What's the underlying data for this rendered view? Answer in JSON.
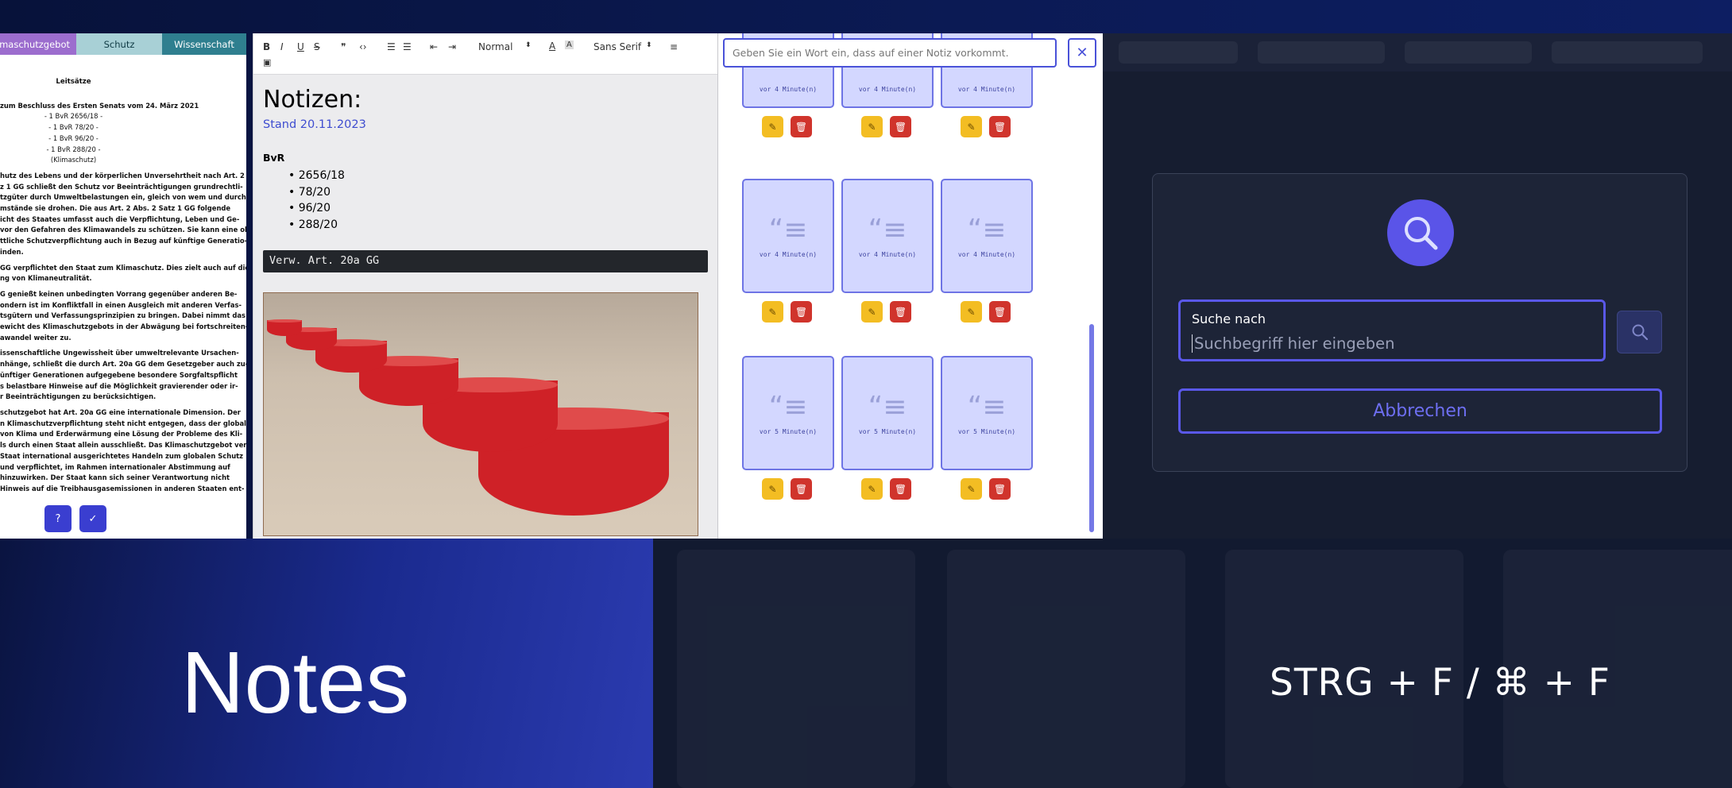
{
  "doc": {
    "tabs": [
      "Klimaschutzgebot",
      "Schutz",
      "Wissenschaft"
    ],
    "heading": "Leitsätze",
    "lines": [
      {
        "text": "zum Beschluss des Ersten Senats vom 24. März 2021",
        "bold": true
      },
      {
        "text": "- 1 BvR 2656/18 -",
        "center": true
      },
      {
        "text": "- 1 BvR 78/20 -",
        "center": true
      },
      {
        "text": "- 1 BvR 96/20 -",
        "center": true
      },
      {
        "text": "- 1 BvR 288/20 -",
        "center": true
      },
      {
        "text": "(Klimaschutz)",
        "center": true
      },
      {
        "text": "",
        "gap": true
      },
      {
        "text": "hutz des Lebens und der körperlichen Unversehrtheit nach Art. 2",
        "bold": true
      },
      {
        "text": "z 1 GG schließt den Schutz vor Beeinträchtigungen grundrechtli-",
        "bold": true
      },
      {
        "text": "tzgüter durch Umweltbelastungen ein, gleich von wem und durch",
        "bold": true
      },
      {
        "text": "mstände sie drohen. Die aus Art. 2 Abs. 2 Satz 1 GG folgende",
        "bold": true
      },
      {
        "text": "icht des Staates umfasst auch die Verpflichtung, Leben und Ge-",
        "bold": true
      },
      {
        "text": "vor den Gefahren des Klimawandels zu schützen. Sie kann eine ob-",
        "bold": true
      },
      {
        "text": "ttliche Schutzverpflichtung auch in Bezug auf künftige Generatio-",
        "bold": true
      },
      {
        "text": "inden.",
        "bold": true
      },
      {
        "text": "",
        "gap": true
      },
      {
        "text": "GG verpflichtet den Staat zum Klimaschutz. Dies zielt auch auf die",
        "bold": true
      },
      {
        "text": "ng von Klimaneutralität.",
        "bold": true
      },
      {
        "text": "",
        "gap": true
      },
      {
        "text": "G genießt keinen unbedingten Vorrang gegenüber anderen Be-",
        "bold": true
      },
      {
        "text": "ondern ist im Konfliktfall in einen Ausgleich mit anderen Verfas-",
        "bold": true
      },
      {
        "text": "tsgütern und Verfassungsprinzipien zu bringen. Dabei nimmt das",
        "bold": true
      },
      {
        "text": "ewicht des Klimaschutzgebots in der Abwägung bei fortschreiten-",
        "bold": true
      },
      {
        "text": "awandel weiter zu.",
        "bold": true
      },
      {
        "text": "",
        "gap": true
      },
      {
        "text": "issenschaftliche Ungewissheit über umweltrelevante Ursachen-",
        "bold": true
      },
      {
        "text": "nhänge, schließt die durch Art. 20a GG dem Gesetzgeber auch zu-",
        "bold": true
      },
      {
        "text": "ünftiger Generationen aufgegebene besondere Sorgfaltspflicht",
        "bold": true
      },
      {
        "text": "s belastbare Hinweise auf die Möglichkeit gravierender oder ir-",
        "bold": true
      },
      {
        "text": "r Beeinträchtigungen zu berücksichtigen.",
        "bold": true
      },
      {
        "text": "",
        "gap": true
      },
      {
        "text": "schutzgebot hat Art. 20a GG eine internationale Dimension. Der",
        "bold": true
      },
      {
        "text": "n Klimaschutzverpflichtung steht nicht entgegen, dass der globale",
        "bold": true
      },
      {
        "text": "von Klima und Erderwärmung eine Lösung der Probleme des Kli-",
        "bold": true
      },
      {
        "text": "ls durch einen Staat allein ausschließt. Das Klimaschutzgebot ver-",
        "bold": true
      },
      {
        "text": "Staat international ausgerichtetes Handeln zum globalen Schutz",
        "bold": true
      },
      {
        "text": "und verpflichtet, im Rahmen internationaler Abstimmung auf",
        "bold": true
      },
      {
        "text": "hinzuwirken. Der Staat kann sich seiner Verantwortung nicht",
        "bold": true
      },
      {
        "text": "Hinweis auf die Treibhausgasemissionen in anderen Staaten ent-",
        "bold": true
      }
    ],
    "buttons": [
      {
        "icon": "help-icon",
        "glyph": "?"
      },
      {
        "icon": "check-icon",
        "glyph": "✓"
      }
    ]
  },
  "editor": {
    "toolbar": {
      "bold": "B",
      "italic": "I",
      "underline": "U",
      "strike": "S",
      "quote": "❞",
      "code": "‹›",
      "ordered_list": "☰",
      "bullet_list": "☰",
      "outdent": "⇤",
      "indent": "⇥",
      "heading_select": "Normal",
      "font_select": "Sans Serif",
      "color": "A",
      "background": "A",
      "align": "≡",
      "image": "▣"
    },
    "title": "Notizen:",
    "subtitle": "Stand 20.11.2023",
    "list_heading": "BvR",
    "list": [
      "2656/18",
      "78/20",
      "96/20",
      "288/20"
    ],
    "code": "Verw. Art. 20a GG"
  },
  "notes": {
    "search_placeholder": "Geben Sie ein Wort ein, dass auf einer Notiz vorkommt.",
    "close_glyph": "✕",
    "rows": [
      {
        "time": "vor 4 Minute(n)",
        "partial": true
      },
      {
        "time": "vor 4 Minute(n)"
      },
      {
        "time": "vor 5 Minute(n)"
      }
    ],
    "edit_glyph": "✎",
    "delete_glyph": "🗑"
  },
  "dialog": {
    "label": "Suche nach",
    "placeholder": "Suchbegriff hier eingeben",
    "cancel": "Abbrechen"
  },
  "banner": {
    "title": "Notes",
    "shortcut": "STRG + F / ⌘ + F"
  },
  "colors": {
    "accent": "#5a58e8",
    "note_bg": "#d3d7ff",
    "edit": "#f3bd23",
    "delete": "#d0342c"
  }
}
